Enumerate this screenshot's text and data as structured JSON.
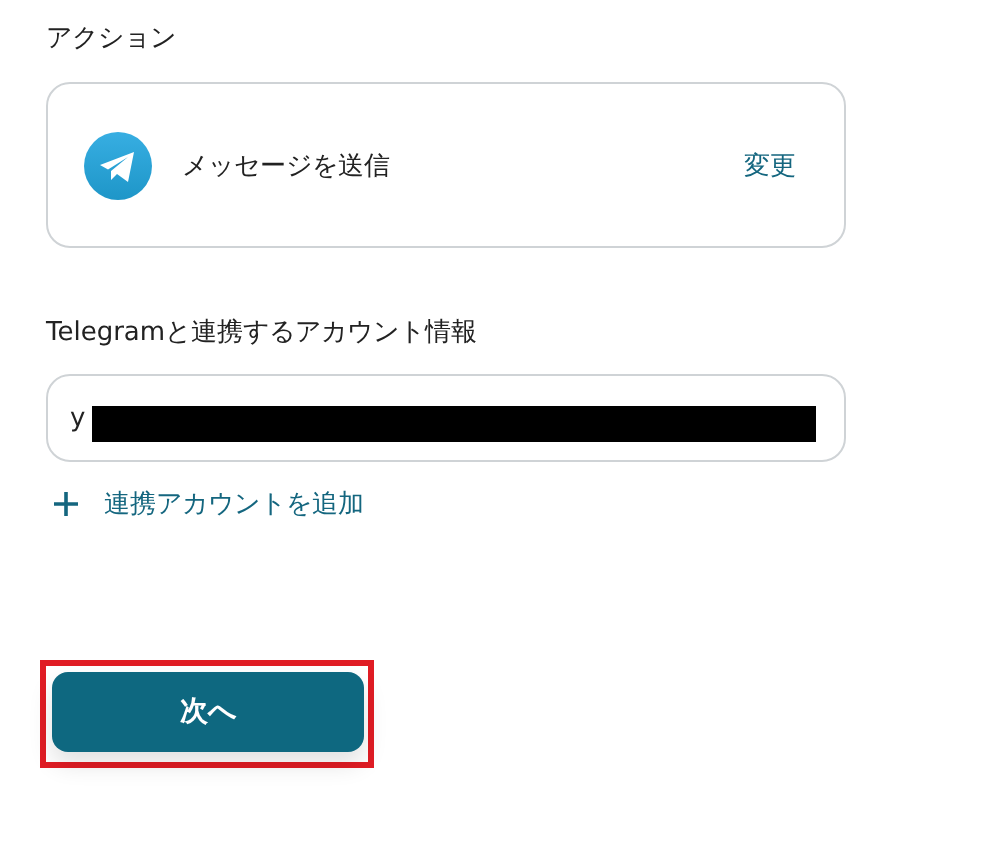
{
  "action_section": {
    "label": "アクション",
    "action": {
      "name": "メッセージを送信",
      "change_link": "変更"
    }
  },
  "account_section": {
    "label": "Telegramと連携するアカウント情報",
    "field_value": "y",
    "redacted": true,
    "add_link": "連携アカウントを追加"
  },
  "next_button": {
    "label": "次へ",
    "highlighted": true
  }
}
